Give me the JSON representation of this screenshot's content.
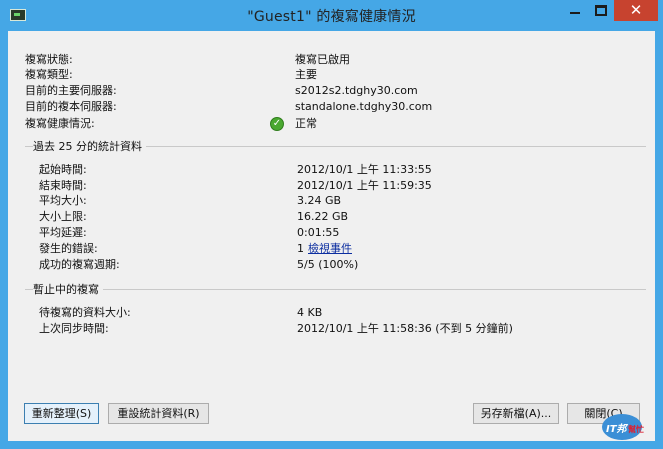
{
  "window": {
    "title": "\"Guest1\" 的複寫健康情況",
    "close_glyph": "✕"
  },
  "summary": [
    {
      "label": "複寫狀態:",
      "value": "複寫已啟用"
    },
    {
      "label": "複寫類型:",
      "value": "主要"
    },
    {
      "label": "目前的主要伺服器:",
      "value": "s2012s2.tdghy30.com"
    },
    {
      "label": "目前的複本伺服器:",
      "value": "standalone.tdghy30.com"
    },
    {
      "label": "複寫健康情況:",
      "value": "正常",
      "icon": "check-icon",
      "icon_color": "#4aa830"
    }
  ],
  "stats_group": {
    "title": "過去 25 分的統計資料",
    "rows": [
      {
        "label": "起始時間:",
        "value": "2012/10/1 上午 11:33:55"
      },
      {
        "label": "結束時間:",
        "value": "2012/10/1 上午 11:59:35"
      },
      {
        "label": "平均大小:",
        "value": "3.24 GB"
      },
      {
        "label": "大小上限:",
        "value": "16.22 GB"
      },
      {
        "label": "平均延遲:",
        "value": "0:01:55"
      },
      {
        "label": "發生的錯誤:",
        "value": "1",
        "link": "檢視事件"
      },
      {
        "label": "成功的複寫週期:",
        "value": "5/5 (100%)"
      }
    ]
  },
  "pending_group": {
    "title": "暫止中的複寫",
    "rows": [
      {
        "label": "待複寫的資料大小:",
        "value": "4 KB"
      },
      {
        "label": "上次同步時間:",
        "value": "2012/10/1 上午 11:58:36 (不到 5 分鐘前)"
      }
    ]
  },
  "buttons": {
    "refresh": "重新整理(S)",
    "reset_stats": "重設統計資料(R)",
    "save_as": "另存新檔(A)...",
    "close": "關閉(C)"
  },
  "colors": {
    "titlebar": "#45a7e6",
    "close_button": "#c7432f",
    "link": "#0b2da0"
  }
}
